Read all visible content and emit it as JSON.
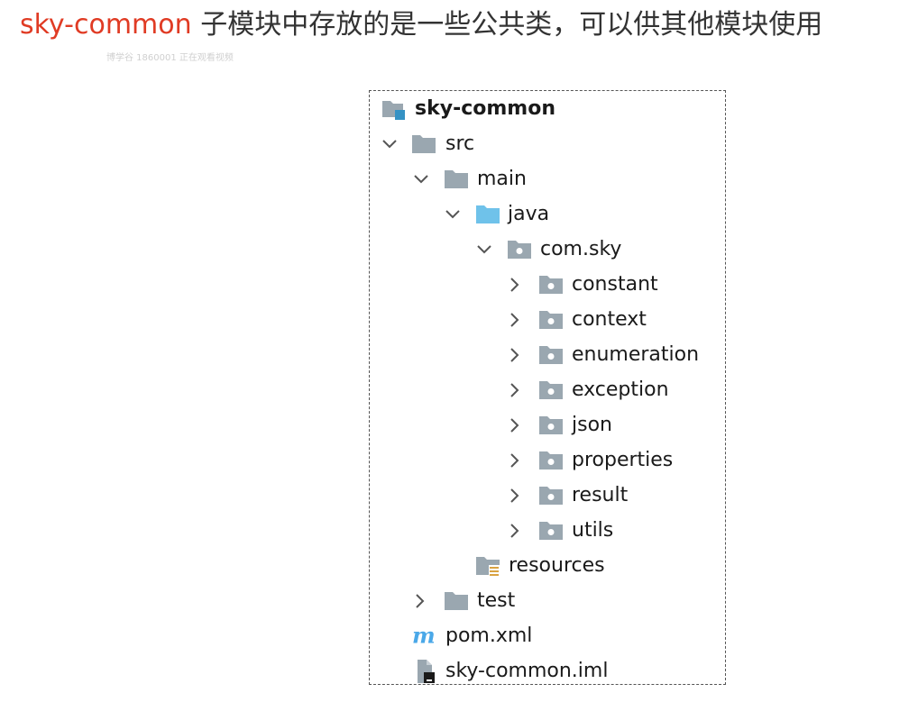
{
  "header": {
    "module_name": "sky-common",
    "description": " 子模块中存放的是一些公共类，可以供其他模块使用"
  },
  "watermark": "博学谷 1860001 正在观看视频",
  "tree": {
    "root": {
      "label": "sky-common",
      "icon": "module-folder-icon"
    },
    "src": {
      "label": "src",
      "icon": "folder-icon",
      "expanded": true
    },
    "main": {
      "label": "main",
      "icon": "folder-icon",
      "expanded": true
    },
    "java": {
      "label": "java",
      "icon": "source-root-folder-icon",
      "expanded": true
    },
    "package": {
      "label": "com.sky",
      "icon": "package-folder-icon",
      "expanded": true
    },
    "packages": [
      {
        "label": "constant",
        "icon": "package-folder-icon",
        "expanded": false
      },
      {
        "label": "context",
        "icon": "package-folder-icon",
        "expanded": false
      },
      {
        "label": "enumeration",
        "icon": "package-folder-icon",
        "expanded": false
      },
      {
        "label": "exception",
        "icon": "package-folder-icon",
        "expanded": false
      },
      {
        "label": "json",
        "icon": "package-folder-icon",
        "expanded": false
      },
      {
        "label": "properties",
        "icon": "package-folder-icon",
        "expanded": false
      },
      {
        "label": "result",
        "icon": "package-folder-icon",
        "expanded": false
      },
      {
        "label": "utils",
        "icon": "package-folder-icon",
        "expanded": false
      }
    ],
    "resources": {
      "label": "resources",
      "icon": "resources-folder-icon"
    },
    "test": {
      "label": "test",
      "icon": "folder-icon",
      "expanded": false
    },
    "pom": {
      "label": "pom.xml",
      "icon": "maven-icon"
    },
    "iml": {
      "label": "sky-common.iml",
      "icon": "iml-file-icon"
    }
  },
  "colors": {
    "module_accent": "#e03b24",
    "heading_text": "#333333",
    "folder_gray": "#9aa7b0",
    "source_blue": "#6fc2ea",
    "module_badge": "#3592c4",
    "maven_blue": "#4aa8e8",
    "resources_yellow": "#d9a343"
  }
}
